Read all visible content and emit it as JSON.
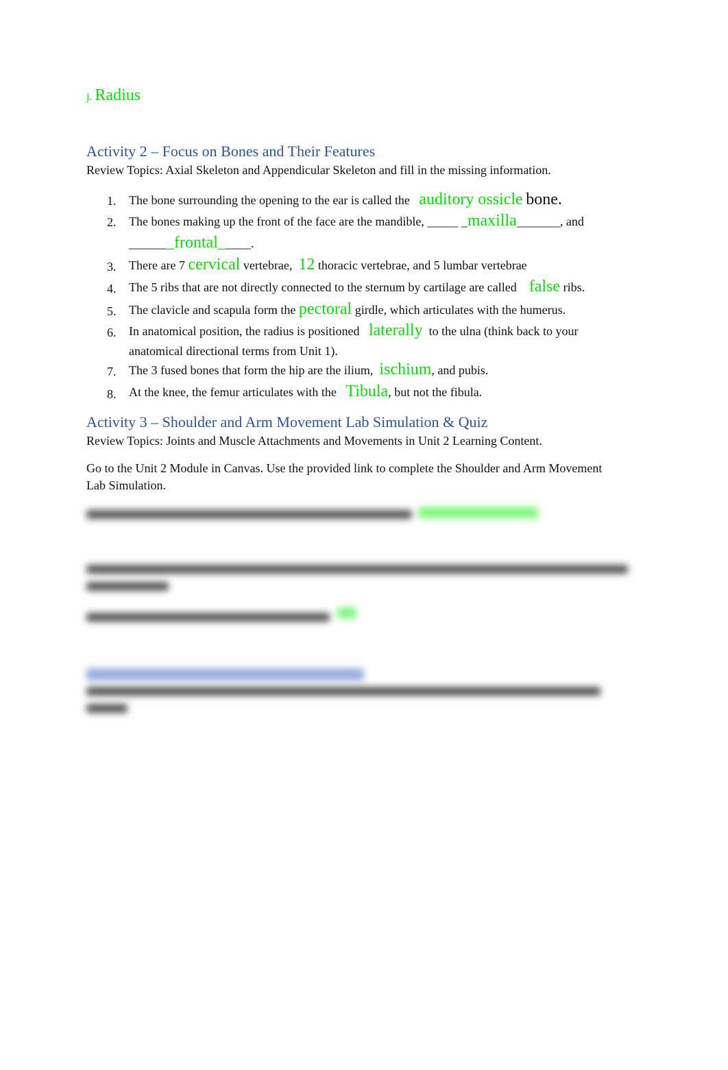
{
  "top": {
    "prefix": "j.",
    "answer": "Radius"
  },
  "activity2": {
    "heading": "Activity 2 – Focus on Bones and Their Features",
    "review": "Review Topics: Axial Skeleton and Appendicular Skeleton and fill in the missing information.",
    "items": [
      {
        "num": "1.",
        "a": "The bone surrounding the opening to the ear is called the",
        "ans": "auditory ossicle",
        "b": "bone."
      },
      {
        "num": "2.",
        "a": "The bones making up the front of the face are the mandible, _____ _",
        "ans": "maxilla",
        "b": "_______, and",
        "a2": "______",
        "ans2": "_frontal_",
        "b2": "____."
      },
      {
        "num": "3.",
        "a": "There are 7",
        "ans": "cervical",
        "b": "vertebrae,",
        "ans2": "12",
        "b2": "thoracic vertebrae, and 5 lumbar vertebrae"
      },
      {
        "num": "4.",
        "a": "The 5 ribs that are not directly connected to the sternum by cartilage are called",
        "ans": "false",
        "b": "ribs."
      },
      {
        "num": "5.",
        "a": "The clavicle and scapula form the",
        "ans": "pectoral",
        "b": "girdle, which articulates with the humerus."
      },
      {
        "num": "6.",
        "a": "In anatomical position, the radius is positioned",
        "ans": "laterally",
        "b": "to the ulna (think back to your",
        "b2": "anatomical directional terms from Unit 1)."
      },
      {
        "num": "7.",
        "a": "The 3 fused bones that form the hip are the ilium,",
        "ans": "ischium",
        "b": ", and pubis."
      },
      {
        "num": "8.",
        "a": "At the knee, the femur articulates with the",
        "ans": "Tibula",
        "b": ", but not the fibula."
      }
    ]
  },
  "activity3": {
    "heading": "Activity 3 – Shoulder and Arm Movement Lab Simulation & Quiz",
    "review": "Review Topics: Joints and Muscle Attachments and Movements in Unit 2 Learning Content.",
    "instructions_1": "Go to the Unit 2 Module in Canvas. Use the provided link to complete the Shoulder and Arm Movement",
    "instructions_2": "Lab Simulation."
  },
  "colors": {
    "answer": "#00e000",
    "heading": "#2f5496"
  }
}
